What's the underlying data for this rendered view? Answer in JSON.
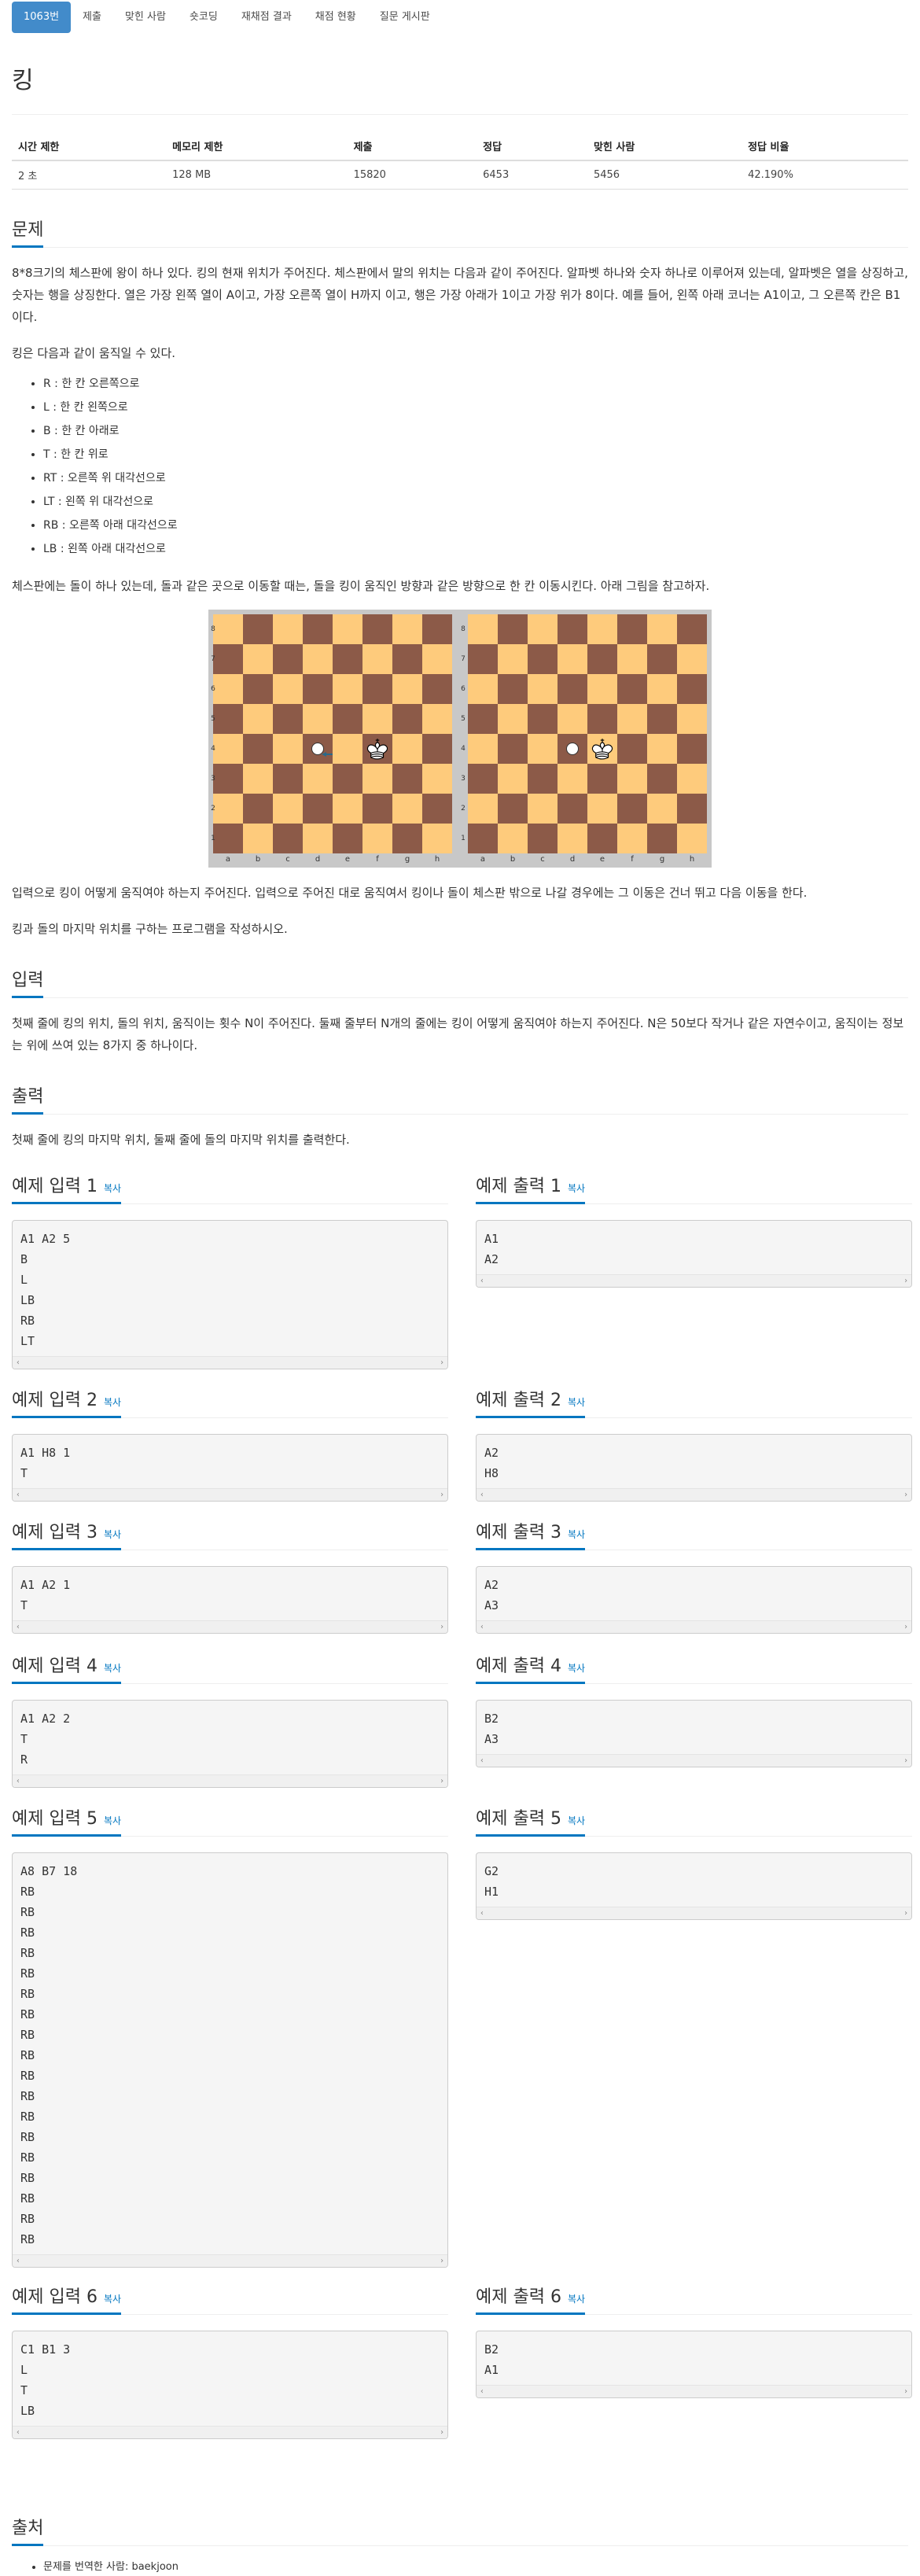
{
  "tabs": [
    {
      "label": "1063번",
      "active": true
    },
    {
      "label": "제출",
      "active": false
    },
    {
      "label": "맞힌 사람",
      "active": false
    },
    {
      "label": "숏코딩",
      "active": false
    },
    {
      "label": "재채점 결과",
      "active": false
    },
    {
      "label": "채점 현황",
      "active": false
    },
    {
      "label": "질문 게시판",
      "active": false
    }
  ],
  "title": "킹",
  "stats": {
    "headers": [
      "시간 제한",
      "메모리 제한",
      "제출",
      "정답",
      "맞힌 사람",
      "정답 비율"
    ],
    "values": [
      "2 초",
      "128 MB",
      "15820",
      "6453",
      "5456",
      "42.190%"
    ]
  },
  "problem": {
    "heading": "문제",
    "p1": "8*8크기의 체스판에 왕이 하나 있다. 킹의 현재 위치가 주어진다. 체스판에서 말의 위치는 다음과 같이 주어진다. 알파벳 하나와 숫자 하나로 이루어져 있는데, 알파벳은 열을 상징하고, 숫자는 행을 상징한다. 열은 가장 왼쪽 열이 A이고, 가장 오른쪽 열이 H까지 이고, 행은 가장 아래가 1이고 가장 위가 8이다. 예를 들어, 왼쪽 아래 코너는 A1이고, 그 오른쪽 칸은 B1이다.",
    "p2": "킹은 다음과 같이 움직일 수 있다.",
    "moves": [
      "R : 한 칸 오른쪽으로",
      "L : 한 칸 왼쪽으로",
      "B : 한 칸 아래로",
      "T : 한 칸 위로",
      "RT : 오른쪽 위 대각선으로",
      "LT : 왼쪽 위 대각선으로",
      "RB : 오른쪽 아래 대각선으로",
      "LB : 왼쪽 아래 대각선으로"
    ],
    "p3": "체스판에는 돌이 하나 있는데, 돌과 같은 곳으로 이동할 때는, 돌을 킹이 움직인 방향과 같은 방향으로 한 칸 이동시킨다. 아래 그림을 참고하자.",
    "p4": "입력으로 킹이 어떻게 움직여야 하는지 주어진다. 입력으로 주어진 대로 움직여서 킹이나 돌이 체스판 밖으로 나갈 경우에는 그 이동은 건너 뛰고 다음 이동을 한다.",
    "p5": "킹과 돌의 마지막 위치를 구하는 프로그램을 작성하시오."
  },
  "board": {
    "ranks": [
      "8",
      "7",
      "6",
      "5",
      "4",
      "3",
      "2",
      "1"
    ],
    "files": [
      "a",
      "b",
      "c",
      "d",
      "e",
      "f",
      "g",
      "h"
    ]
  },
  "input": {
    "heading": "입력",
    "text": "첫째 줄에 킹의 위치, 돌의 위치, 움직이는 횟수 N이 주어진다. 둘째 줄부터 N개의 줄에는 킹이 어떻게 움직여야 하는지 주어진다. N은 50보다 작거나 같은 자연수이고, 움직이는 정보는 위에 쓰여 있는 8가지 중 하나이다."
  },
  "output": {
    "heading": "출력",
    "text": "첫째 줄에 킹의 마지막 위치, 둘째 줄에 돌의 마지막 위치를 출력한다."
  },
  "copy_label": "복사",
  "samples": [
    {
      "in_title": "예제 입력 1",
      "out_title": "예제 출력 1",
      "in": "A1 A2 5\nB\nL\nLB\nRB\nLT",
      "out": "A1\nA2"
    },
    {
      "in_title": "예제 입력 2",
      "out_title": "예제 출력 2",
      "in": "A1 H8 1\nT",
      "out": "A2\nH8"
    },
    {
      "in_title": "예제 입력 3",
      "out_title": "예제 출력 3",
      "in": "A1 A2 1\nT",
      "out": "A2\nA3"
    },
    {
      "in_title": "예제 입력 4",
      "out_title": "예제 출력 4",
      "in": "A1 A2 2\nT\nR",
      "out": "B2\nA3"
    },
    {
      "in_title": "예제 입력 5",
      "out_title": "예제 출력 5",
      "in": "A8 B7 18\nRB\nRB\nRB\nRB\nRB\nRB\nRB\nRB\nRB\nRB\nRB\nRB\nRB\nRB\nRB\nRB\nRB\nRB",
      "out": "G2\nH1"
    },
    {
      "in_title": "예제 입력 6",
      "out_title": "예제 출력 6",
      "in": "C1 B1 3\nL\nT\nLB",
      "out": "B2\nA1"
    }
  ],
  "source": {
    "heading": "출처",
    "item": "문제를 번역한 사람: baekjoon"
  }
}
